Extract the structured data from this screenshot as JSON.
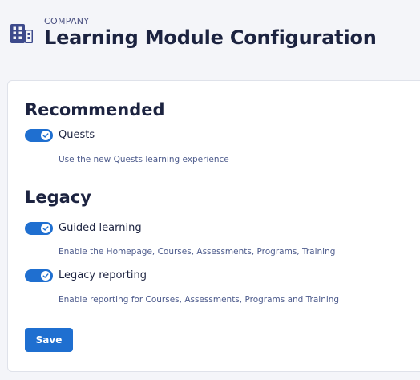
{
  "header": {
    "eyebrow": "COMPANY",
    "title": "Learning Module Configuration",
    "icon": "building-icon"
  },
  "sections": [
    {
      "title": "Recommended",
      "options": [
        {
          "label": "Quests",
          "description": "Use the new Quests learning experience",
          "enabled": true
        }
      ]
    },
    {
      "title": "Legacy",
      "options": [
        {
          "label": "Guided learning",
          "description": "Enable the Homepage, Courses, Assessments, Programs, Training",
          "enabled": true
        },
        {
          "label": "Legacy reporting",
          "description": "Enable reporting for Courses, Assessments, Programs and Training",
          "enabled": true
        }
      ]
    }
  ],
  "actions": {
    "save_label": "Save"
  },
  "colors": {
    "accent": "#1f6fd0",
    "icon": "#3d4a8c",
    "text": "#1c2340",
    "muted": "#4d5b8c"
  }
}
